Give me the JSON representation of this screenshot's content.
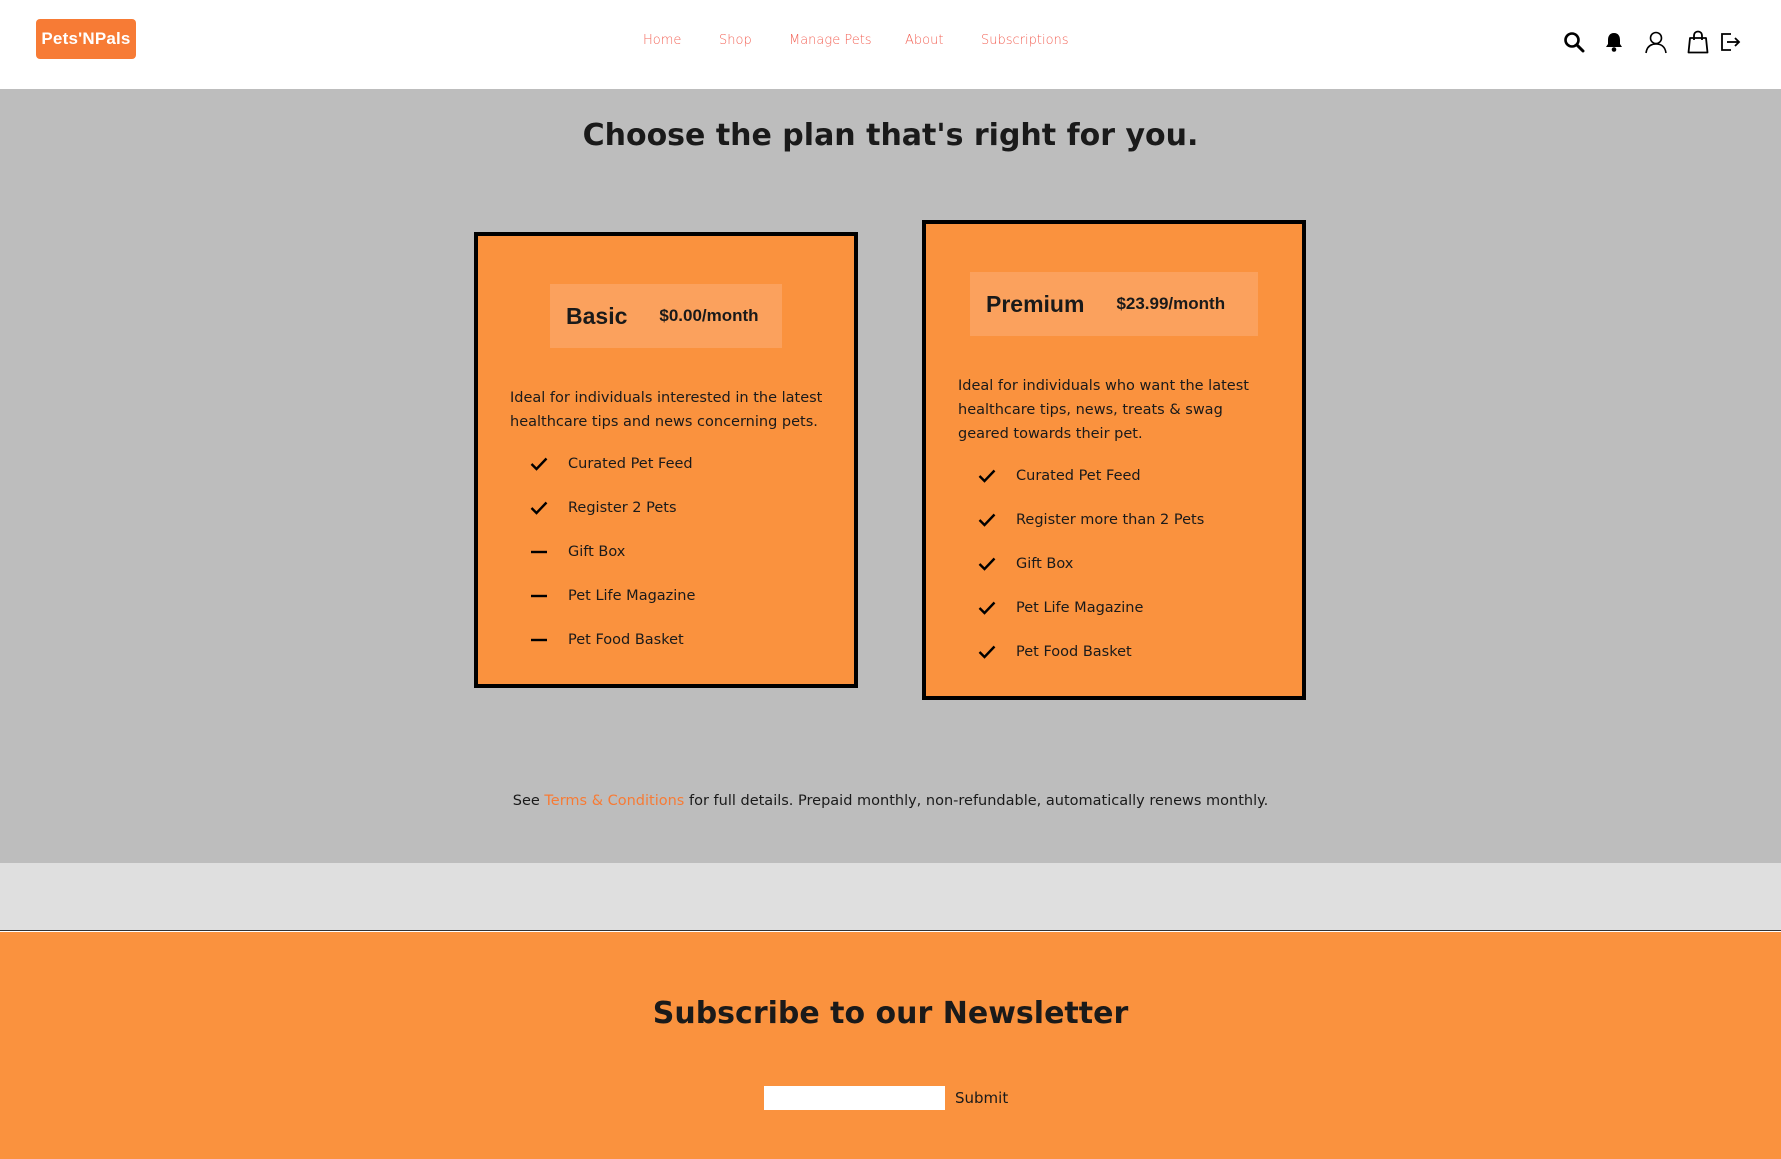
{
  "brand": {
    "logo_text": "Pets'NPals",
    "accent_color": "#f77b35",
    "nav_color": "#f3665a"
  },
  "nav": {
    "items": [
      {
        "label": "Home"
      },
      {
        "label": "Shop"
      },
      {
        "label": "Manage Pets"
      },
      {
        "label": "About"
      },
      {
        "label": "Subscriptions"
      }
    ]
  },
  "header_icons": [
    "search-icon",
    "bell-icon",
    "user-icon",
    "shopping-bag-icon",
    "logout-icon"
  ],
  "main": {
    "headline": "Choose the plan that's right for you.",
    "plans": [
      {
        "name": "Basic",
        "price": "$0.00/month",
        "description": "Ideal for individuals interested in the latest healthcare tips and news concerning pets.",
        "features": [
          {
            "label": "Curated Pet Feed",
            "included": true
          },
          {
            "label": "Register 2 Pets",
            "included": true
          },
          {
            "label": "Gift Box",
            "included": false
          },
          {
            "label": "Pet Life Magazine",
            "included": false
          },
          {
            "label": "Pet Food Basket",
            "included": false
          }
        ]
      },
      {
        "name": "Premium",
        "price": "$23.99/month",
        "description": "Ideal for individuals who want the latest healthcare tips, news, treats & swag geared towards their pet.",
        "features": [
          {
            "label": "Curated Pet Feed",
            "included": true
          },
          {
            "label": "Register more than 2 Pets",
            "included": true
          },
          {
            "label": "Gift Box",
            "included": true
          },
          {
            "label": "Pet Life Magazine",
            "included": true
          },
          {
            "label": "Pet Food Basket",
            "included": true
          }
        ]
      }
    ],
    "terms": {
      "prefix": "See ",
      "link": "Terms & Conditions",
      "suffix": " for full details. Prepaid monthly, non-refundable, automatically renews monthly."
    }
  },
  "footer": {
    "newsletter_title": "Subscribe to our Newsletter",
    "email_value": "",
    "submit_label": "Submit"
  }
}
